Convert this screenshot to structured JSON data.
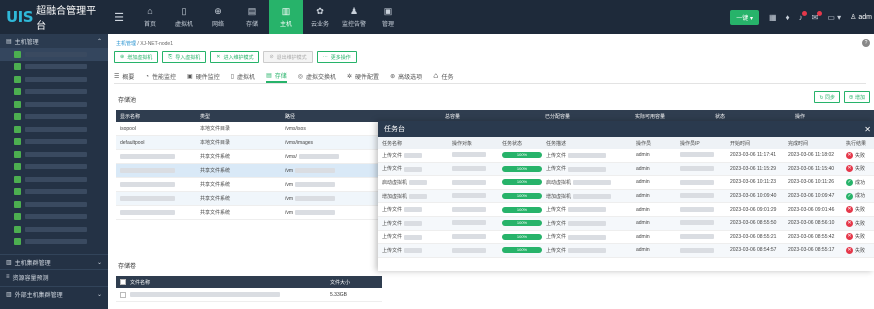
{
  "header": {
    "logo": "UIS",
    "product": "超融合管理平台",
    "nav": [
      {
        "label": "首页",
        "icon": "⌂",
        "name": "home"
      },
      {
        "label": "虚拟机",
        "icon": "▯",
        "name": "vm"
      },
      {
        "label": "网络",
        "icon": "⊕",
        "name": "network"
      },
      {
        "label": "存储",
        "icon": "▤",
        "name": "storage"
      },
      {
        "label": "主机",
        "icon": "▥",
        "name": "host"
      },
      {
        "label": "云业务",
        "icon": "✿",
        "name": "cloud"
      },
      {
        "label": "监控告警",
        "icon": "♟",
        "name": "monitor"
      },
      {
        "label": "管理",
        "icon": "▣",
        "name": "manage"
      }
    ],
    "active_nav": 4,
    "oneclick_label": "一键 ▾",
    "user": "adm",
    "accent": "#27b36a"
  },
  "sidebar": {
    "title": "主机管理",
    "footer": [
      "主机集群管理",
      "资源容量预测",
      "外部主机集群管理"
    ]
  },
  "breadcrumb": {
    "root": "主机管理",
    "current": "XJ-NET-node1"
  },
  "actions": [
    {
      "label": "增加虚拟机",
      "icon": "⊕",
      "disabled": false
    },
    {
      "label": "导入虚拟机",
      "icon": "⎘",
      "disabled": false
    },
    {
      "label": "进入维护模式",
      "icon": "✕",
      "disabled": false
    },
    {
      "label": "退出维护模式",
      "icon": "⊘",
      "disabled": true
    },
    {
      "label": "更多操作",
      "icon": "⋯",
      "disabled": false
    }
  ],
  "tabs": [
    {
      "label": "概要",
      "icon": "☰"
    },
    {
      "label": "性能监控",
      "icon": "◔"
    },
    {
      "label": "硬件监控",
      "icon": "▣"
    },
    {
      "label": "虚拟机",
      "icon": "▯"
    },
    {
      "label": "存储",
      "icon": "▤"
    },
    {
      "label": "虚拟交换机",
      "icon": "◎"
    },
    {
      "label": "硬件配置",
      "icon": "✲"
    },
    {
      "label": "高级选项",
      "icon": "⊛"
    },
    {
      "label": "任务",
      "icon": "♺"
    }
  ],
  "active_tab": 4,
  "storage": {
    "title": "存储池",
    "sync_label": "↻ 同步",
    "add_label": "⊕ 增加",
    "columns": [
      "显示名称",
      "类型",
      "路径",
      "总容量",
      "已分配容量",
      "实际可用容量",
      "状态",
      "操作"
    ],
    "rows": [
      {
        "name": "isopool",
        "type": "本地文件目录",
        "path": "/vms/isos"
      },
      {
        "name": "defaultpool",
        "type": "本地文件目录",
        "path": "/vms/images"
      },
      {
        "name": "",
        "type": "共享文件系统",
        "path": "/vms/"
      },
      {
        "name": "",
        "type": "共享文件系统",
        "path": "/vm"
      },
      {
        "name": "",
        "type": "共享文件系统",
        "path": "/vm"
      },
      {
        "name": "",
        "type": "共享文件系统",
        "path": "/vm"
      },
      {
        "name": "",
        "type": "共享文件系统",
        "path": "/vm"
      }
    ]
  },
  "volumes": {
    "title": "存储卷",
    "columns": [
      "文件名称",
      "文件大小"
    ],
    "rows": [
      {
        "name": "",
        "size": "5.33GB"
      }
    ]
  },
  "task_panel": {
    "title": "任务台",
    "columns": [
      "任务名称",
      "操作对象",
      "任务状态",
      "任务描述",
      "操作员",
      "操作员IP",
      "开始时间",
      "完成时间",
      "执行结果"
    ],
    "rows": [
      {
        "name": "上传文件",
        "progress": 1.0,
        "progress_label": "100%",
        "desc": "上传文件",
        "op": "admin",
        "start": "2023-03-06 11:17:41",
        "end": "2023-03-06 11:18:02",
        "result": "失败",
        "ok": false
      },
      {
        "name": "上传文件",
        "progress": 1.0,
        "progress_label": "100%",
        "desc": "上传文件",
        "op": "admin",
        "start": "2023-03-06 11:15:29",
        "end": "2023-03-06 11:15:40",
        "result": "失败",
        "ok": false
      },
      {
        "name": "启动虚拟机",
        "progress": 1.0,
        "progress_label": "100%",
        "desc": "启动虚拟机",
        "op": "admin",
        "start": "2023-03-06 10:11:23",
        "end": "2023-03-06 10:11:26",
        "result": "成功",
        "ok": true
      },
      {
        "name": "增加虚拟机",
        "progress": 1.0,
        "progress_label": "100%",
        "desc": "增加虚拟机",
        "op": "admin",
        "start": "2023-03-06 10:09:40",
        "end": "2023-03-06 10:09:47",
        "result": "成功",
        "ok": true
      },
      {
        "name": "上传文件",
        "progress": 1.0,
        "progress_label": "100%",
        "desc": "上传文件",
        "op": "admin",
        "start": "2023-03-06 09:01:29",
        "end": "2023-03-06 09:01:46",
        "result": "失败",
        "ok": false
      },
      {
        "name": "上传文件",
        "progress": 1.0,
        "progress_label": "100%",
        "desc": "上传文件",
        "op": "admin",
        "start": "2023-03-06 08:55:50",
        "end": "2023-03-06 08:56:10",
        "result": "失败",
        "ok": false
      },
      {
        "name": "上传文件",
        "progress": 1.0,
        "progress_label": "100%",
        "desc": "上传文件",
        "op": "admin",
        "start": "2023-03-06 08:55:21",
        "end": "2023-03-06 08:55:42",
        "result": "失败",
        "ok": false
      },
      {
        "name": "上传文件",
        "progress": 1.0,
        "progress_label": "100%",
        "desc": "上传文件",
        "op": "admin",
        "start": "2023-03-06 08:54:57",
        "end": "2023-03-06 08:55:17",
        "result": "失败",
        "ok": false
      }
    ]
  }
}
